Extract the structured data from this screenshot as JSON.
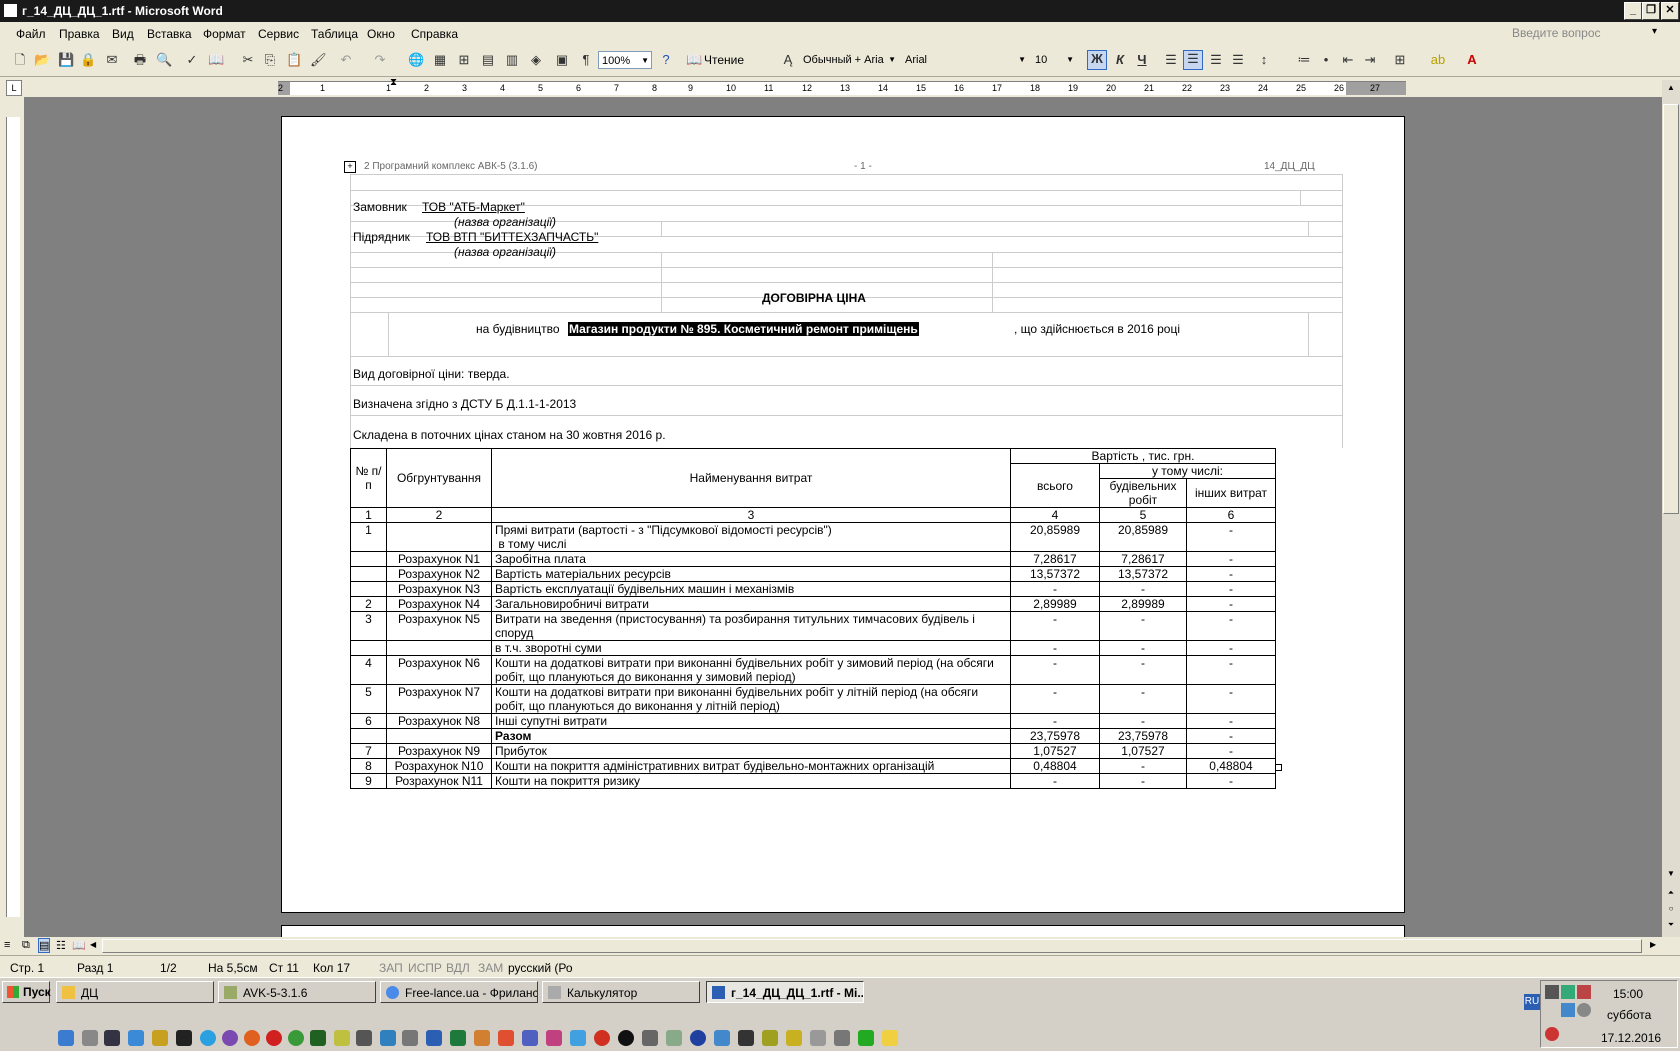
{
  "window": {
    "title": "г_14_ДЦ_ДЦ_1.rtf - Microsoft Word",
    "min": "_",
    "restore": "❐",
    "close": "✕"
  },
  "menu": {
    "items": [
      "Файл",
      "Правка",
      "Вид",
      "Вставка",
      "Формат",
      "Сервис",
      "Таблица",
      "Окно",
      "Справка"
    ],
    "ask_placeholder": "Введите вопрос"
  },
  "toolbar": {
    "zoom": "100%",
    "read_label": "Чтение",
    "style": "Обычный + Aria",
    "font": "Arial",
    "size": "10",
    "bold": "Ж",
    "italic": "К",
    "underline": "Ч"
  },
  "ruler_numbers": [
    "2",
    "1",
    "1",
    "2",
    "3",
    "4",
    "5",
    "6",
    "7",
    "8",
    "9",
    "10",
    "11",
    "12",
    "13",
    "14",
    "15",
    "16",
    "17",
    "18",
    "19",
    "20",
    "21",
    "22",
    "23",
    "24",
    "25",
    "26",
    "27"
  ],
  "document": {
    "header_left": "2 Програмний комплекс АВК-5 (3.1.6)",
    "header_center": "- 1 -",
    "header_right": "14_ДЦ_ДЦ",
    "customer_label": "Замовник",
    "customer_name": "ТОВ \"АТБ-Маркет\"",
    "org_hint": "(назва  організації)",
    "contractor_label": "Підрядник",
    "contractor_name": "ТОВ ВТП \"БИТТЕХЗАПЧАСТЬ\"",
    "title": "ДОГОВІРНА ЦІНА",
    "construction_prefix": "на будівництво",
    "construction_object": "Магазин продукти № 895.  Косметичний ремонт приміщень",
    "construction_suffix": ", що здійснюється в  2016 році",
    "price_type": "Вид договірної ціни:  тверда.",
    "standard": "Визначена згідно з ДСТУ Б Д.1.1-1-2013",
    "compiled": "Складена в поточних цінах станом на  30 жовтня 2016  р."
  },
  "table": {
    "h_no": "№ п/п",
    "h_basis": "Обгрунтування",
    "h_name": "Найменування  витрат",
    "h_cost": "Вартість ,  тис. грн.",
    "h_including": "у тому числі:",
    "h_total": "всього",
    "h_construction": "будівельних робіт",
    "h_other": "інших витрат",
    "numbers": [
      "1",
      "2",
      "3",
      "4",
      "5",
      "6"
    ],
    "rows": [
      {
        "no": "1",
        "basis": "",
        "name": "Прямі витрати (вартості - з \"Підсумкової відомості ресурсів\")\n в тому числі",
        "total": "20,85989",
        "constr": "20,85989",
        "other": "-"
      },
      {
        "no": "",
        "basis": "Розрахунок N1",
        "name": "Заробітна плата",
        "total": "7,28617",
        "constr": "7,28617",
        "other": "-"
      },
      {
        "no": "",
        "basis": "Розрахунок N2",
        "name": "Вартість матеріальних ресурсів",
        "total": "13,57372",
        "constr": "13,57372",
        "other": "-"
      },
      {
        "no": "",
        "basis": "Розрахунок N3",
        "name": "Вартість експлуатації будівельних машин і механізмів",
        "total": "-",
        "constr": "-",
        "other": "-"
      },
      {
        "no": "2",
        "basis": "Розрахунок N4",
        "name": "Загальновиробничі витрати",
        "total": "2,89989",
        "constr": "2,89989",
        "other": "-"
      },
      {
        "no": "3",
        "basis": "Розрахунок N5",
        "name": "Витрати на зведення (пристосування) та розбирання титульних тимчасових будівель і споруд",
        "total": "-",
        "constr": "-",
        "other": "-"
      },
      {
        "no": "",
        "basis": "",
        "name": "в т.ч. зворотні суми",
        "total": "-",
        "constr": "-",
        "other": "-"
      },
      {
        "no": "4",
        "basis": "Розрахунок N6",
        "name": "Кошти на додаткові витрати при виконанні будівельних робіт у зимовий період (на обсяги робіт, що плануються до виконання у зимовий період)",
        "total": "-",
        "constr": "-",
        "other": "-"
      },
      {
        "no": "5",
        "basis": "Розрахунок N7",
        "name": "Кошти на додаткові витрати при виконанні будівельних робіт у літній період (на обсяги робіт, що плануються до виконання у літній період)",
        "total": "-",
        "constr": "-",
        "other": "-"
      },
      {
        "no": "6",
        "basis": "Розрахунок N8",
        "name": "Інші супутні витрати",
        "total": "-",
        "constr": "-",
        "other": "-"
      },
      {
        "no": "",
        "basis": "",
        "name": "Разом",
        "total": "23,75978",
        "constr": "23,75978",
        "other": "-",
        "bold": true
      },
      {
        "no": "7",
        "basis": "Розрахунок N9",
        "name": "Прибуток",
        "total": "1,07527",
        "constr": "1,07527",
        "other": "-"
      },
      {
        "no": "8",
        "basis": "Розрахунок N10",
        "name": "Кошти на покриття адміністративних витрат будівельно-монтажних організацій",
        "total": "0,48804",
        "constr": "-",
        "other": "0,48804"
      },
      {
        "no": "9",
        "basis": "Розрахунок N11",
        "name": "Кошти на покриття ризику",
        "total": "-",
        "constr": "-",
        "other": "-"
      }
    ]
  },
  "status": {
    "page": "Стр.  1",
    "section": "Разд  1",
    "pages": "1/2",
    "at": "На  5,5см",
    "line": "Ст  11",
    "col": "Кол  17",
    "rec": "ЗАП",
    "trk": "ИСПР",
    "ext": "ВДЛ",
    "ovr": "ЗАМ",
    "lang": "русский (Ро"
  },
  "taskbar": {
    "start": "Пуск",
    "tasks": [
      "ДЦ",
      "AVK-5-3.1.6",
      "Free-lance.ua - Фриланс...",
      "Калькулятор",
      "г_14_ДЦ_ДЦ_1.rtf - Mi..."
    ],
    "lang": "RU",
    "time": "15:00",
    "day": "суббота",
    "date": "17.12.2016"
  }
}
